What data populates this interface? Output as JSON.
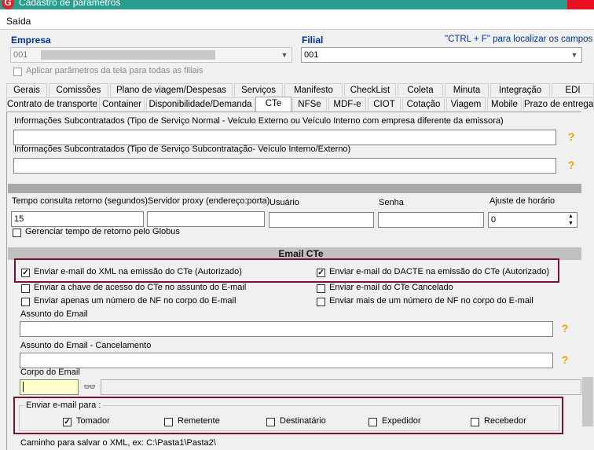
{
  "window": {
    "title": "Cadastro de parâmetros",
    "logo": "G"
  },
  "menu": {
    "saida": "Saída"
  },
  "empresa": {
    "label": "Empresa",
    "value": "001"
  },
  "filial": {
    "label": "Filial",
    "value": "001"
  },
  "hint_text": "\"CTRL + F\" para localizar os campos",
  "aplicar_label": "Aplicar parâmetros da tela para todas as filiais",
  "tabs_row1": [
    "Gerais",
    "Comissões",
    "Plano de viagem/Despesas",
    "Serviços",
    "Manifesto",
    "CheckList",
    "Coleta",
    "Minuta",
    "Integração",
    "EDI"
  ],
  "tabs_row2": [
    "Contrato de transporte",
    "Container",
    "Disponibilidade/Demanda",
    "CTe",
    "NFSe",
    "MDF-e",
    "CIOT",
    "Cotação",
    "Viagem",
    "Mobile",
    "Prazo de entrega"
  ],
  "subcontratados": {
    "label1": "Informações Subcontratados (Tipo de Serviço Normal - Veículo Externo ou Veículo Interno com empresa diferente da emissora)",
    "label2": "Informações Subcontratados (Tipo de Serviço Subcontratação- Veículo Interno/Externo)",
    "help": "?"
  },
  "conn": {
    "tempo_label": "Tempo consulta retorno (segundos)",
    "tempo_value": "15",
    "proxy_label": "Servidor proxy (endereço:porta)",
    "usuario_label": "Usuário",
    "senha_label": "Senha",
    "ajuste_label": "Ajuste de horário",
    "ajuste_value": "0",
    "gerenciar_label": "Gerenciar tempo de retorno pelo Globus"
  },
  "email": {
    "section_title": "Email CTe",
    "xml_label": "Enviar e-mail do XML na emissão do CTe (Autorizado)",
    "dacte_label": "Enviar e-mail do DACTE na emissão do CTe (Autorizado)",
    "chave_label": "Enviar a chave de acesso do CTe no assunto do E-mail",
    "cancelado_label": "Enviar e-mail do CTe Cancelado",
    "apenas_label": "Enviar apenas um número de NF no corpo do E-mail",
    "mais_label": "Enviar mais de um número de NF no corpo do E-mail",
    "assunto_label": "Assunto do Email",
    "assunto_canc_label": "Assunto do Email - Cancelamento",
    "corpo_label": "Corpo do Email",
    "enviar_para_label": "Enviar e-mail para :",
    "recipients": [
      "Tomador",
      "Remetente",
      "Destinatário",
      "Expedidor",
      "Recebedor"
    ],
    "caminho_label": "Caminho para salvar o XML, ex: C:\\Pasta1\\Pasta2\\"
  },
  "colors": {
    "titlebar": "#2a9d8f",
    "label_blue": "#003399",
    "highlight_red": "#7a1427",
    "help_icon": "#e7a600"
  }
}
